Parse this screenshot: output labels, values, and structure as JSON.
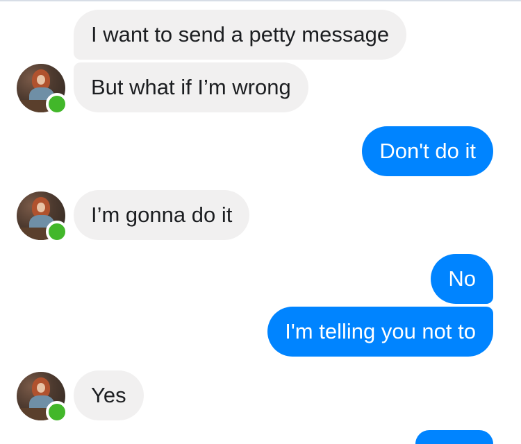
{
  "messages": [
    {
      "side": "incoming",
      "text": "I want to send a petty message"
    },
    {
      "side": "incoming",
      "text": "But what if I’m wrong"
    },
    {
      "side": "outgoing",
      "text": "Don't do it"
    },
    {
      "side": "incoming",
      "text": "I’m gonna do it"
    },
    {
      "side": "outgoing",
      "text": "No"
    },
    {
      "side": "outgoing",
      "text": "I'm telling you not to"
    },
    {
      "side": "incoming",
      "text": "Yes"
    }
  ],
  "colors": {
    "outgoing_bubble": "#0084ff",
    "incoming_bubble": "#f1f0f0",
    "online_indicator": "#42b72a"
  },
  "contact": {
    "avatar_icon": "avatar-photo",
    "status": "online"
  }
}
